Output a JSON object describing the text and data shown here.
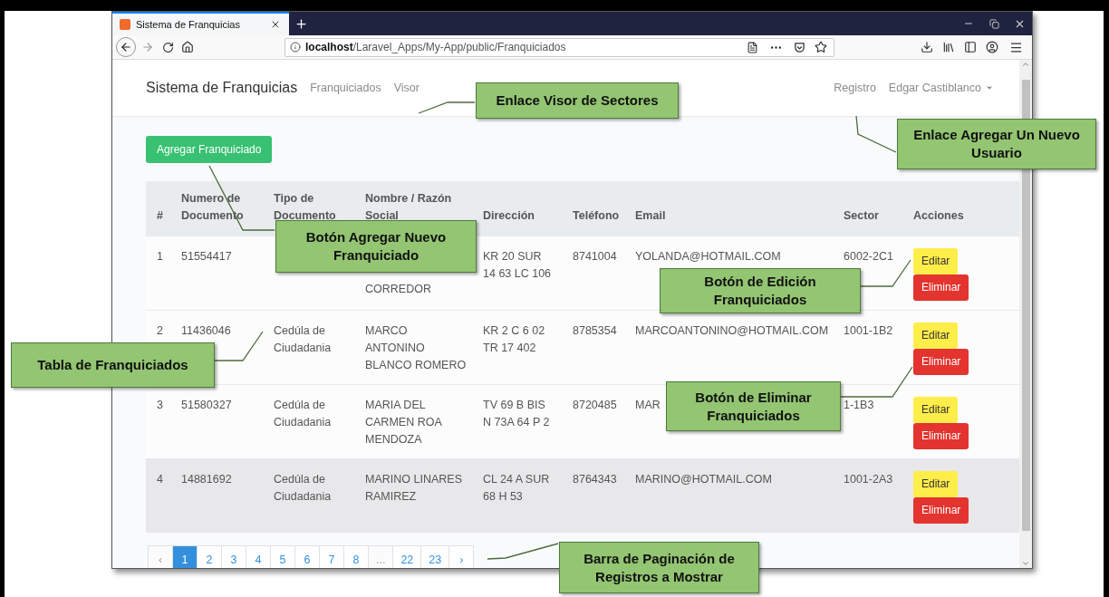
{
  "browser": {
    "tab_title": "Sistema de Franquicias",
    "url": "**localhost**/Laravel_Apps/My-App/public/Franquiciados"
  },
  "navbar": {
    "brand": "Sistema de Franquicias",
    "links": [
      {
        "label": "Franquiciados"
      },
      {
        "label": "Visor"
      }
    ],
    "right_links": [
      {
        "label": "Registro",
        "kind": "link"
      },
      {
        "label": "Edgar Castiblanco",
        "kind": "dropdown"
      }
    ]
  },
  "add_button": "Agregar Franquiciado",
  "table": {
    "columns": [
      [
        "#"
      ],
      [
        "Numero de",
        "Documento"
      ],
      [
        "Tipo de",
        "Documento"
      ],
      [
        "Nombre / Razón",
        "Social"
      ],
      [
        "Dirección"
      ],
      [
        "Teléfono"
      ],
      [
        "Email"
      ],
      [
        "Sector"
      ],
      [
        "Acciones"
      ]
    ],
    "rows": [
      {
        "number": "1",
        "document": "51554417",
        "name": [
          "CORREDOR"
        ],
        "address": [
          "KR 20 SUR",
          "14 63 LC 106"
        ],
        "phone": "8741004",
        "email": "YOLANDA@HOTMAIL.COM",
        "sector": "6002-2C1",
        "overlaid": true,
        "selected": false,
        "actions": [
          {
            "label": "Editar",
            "kind": "edit"
          },
          {
            "label": "Eliminar",
            "kind": "delete"
          }
        ]
      },
      {
        "number": "2",
        "document": "11436046",
        "document_type": [
          "Cedúla de",
          "Ciudadania"
        ],
        "name": [
          "MARCO",
          "ANTONINO",
          "BLANCO ROMERO"
        ],
        "address": [
          "KR 2 C 6 02",
          "TR 17 402"
        ],
        "phone": "8785354",
        "email": "MARCOANTONINO@HOTMAIL.COM",
        "sector": "1001-1B2",
        "overlaid": false,
        "selected": false,
        "actions": [
          {
            "label": "Editar",
            "kind": "edit"
          },
          {
            "label": "Eliminar",
            "kind": "delete"
          }
        ]
      },
      {
        "number": "3",
        "document": "51580327",
        "document_type": [
          "Cedúla de",
          "Ciudadania"
        ],
        "name": [
          "MARIA DEL",
          "CARMEN ROA",
          "MENDOZA"
        ],
        "address": [
          "TV 69 B BIS",
          "N 73A 64 P 2"
        ],
        "phone": "8720485",
        "email": "MAR",
        "sector": "1-1B3",
        "overlaid": false,
        "selected": false,
        "actions": [
          {
            "label": "Editar",
            "kind": "edit"
          },
          {
            "label": "Eliminar",
            "kind": "delete"
          }
        ]
      },
      {
        "number": "4",
        "document": "14881692",
        "document_type": [
          "Cedúla de",
          "Ciudadania"
        ],
        "name": [
          "MARINO LINARES",
          "RAMIREZ"
        ],
        "address": [
          "CL 24 A SUR",
          "68 H 53"
        ],
        "phone": "8764343",
        "email": "MARINO@HOTMAIL.COM",
        "sector": "1001-2A3",
        "overlaid": false,
        "selected": true,
        "actions": [
          {
            "label": "Editar",
            "kind": "edit"
          },
          {
            "label": "Eliminar",
            "kind": "delete"
          }
        ]
      }
    ]
  },
  "pagination": [
    {
      "label": "‹",
      "selected": false,
      "disabled": true
    },
    {
      "label": "1",
      "selected": true,
      "disabled": false
    },
    {
      "label": "2",
      "selected": false,
      "disabled": false
    },
    {
      "label": "3",
      "selected": false,
      "disabled": false
    },
    {
      "label": "4",
      "selected": false,
      "disabled": false
    },
    {
      "label": "5",
      "selected": false,
      "disabled": false
    },
    {
      "label": "6",
      "selected": false,
      "disabled": false
    },
    {
      "label": "7",
      "selected": false,
      "disabled": false
    },
    {
      "label": "8",
      "selected": false,
      "disabled": false
    },
    {
      "label": "...",
      "selected": false,
      "disabled": true
    },
    {
      "label": "22",
      "selected": false,
      "disabled": false
    },
    {
      "label": "23",
      "selected": false,
      "disabled": false
    },
    {
      "label": "›",
      "selected": false,
      "disabled": false
    }
  ],
  "callouts": [
    "Enlace Visor de Sectores",
    "Enlace Agregar Un Nuevo Usuario",
    "Botón Agregar Nuevo Franquiciado",
    "Tabla de Franquiciados",
    "Botón de Edición Franquiciados",
    "Botón de Eliminar Franquiciados",
    "Barra de Paginación de Registros a Mostrar"
  ]
}
